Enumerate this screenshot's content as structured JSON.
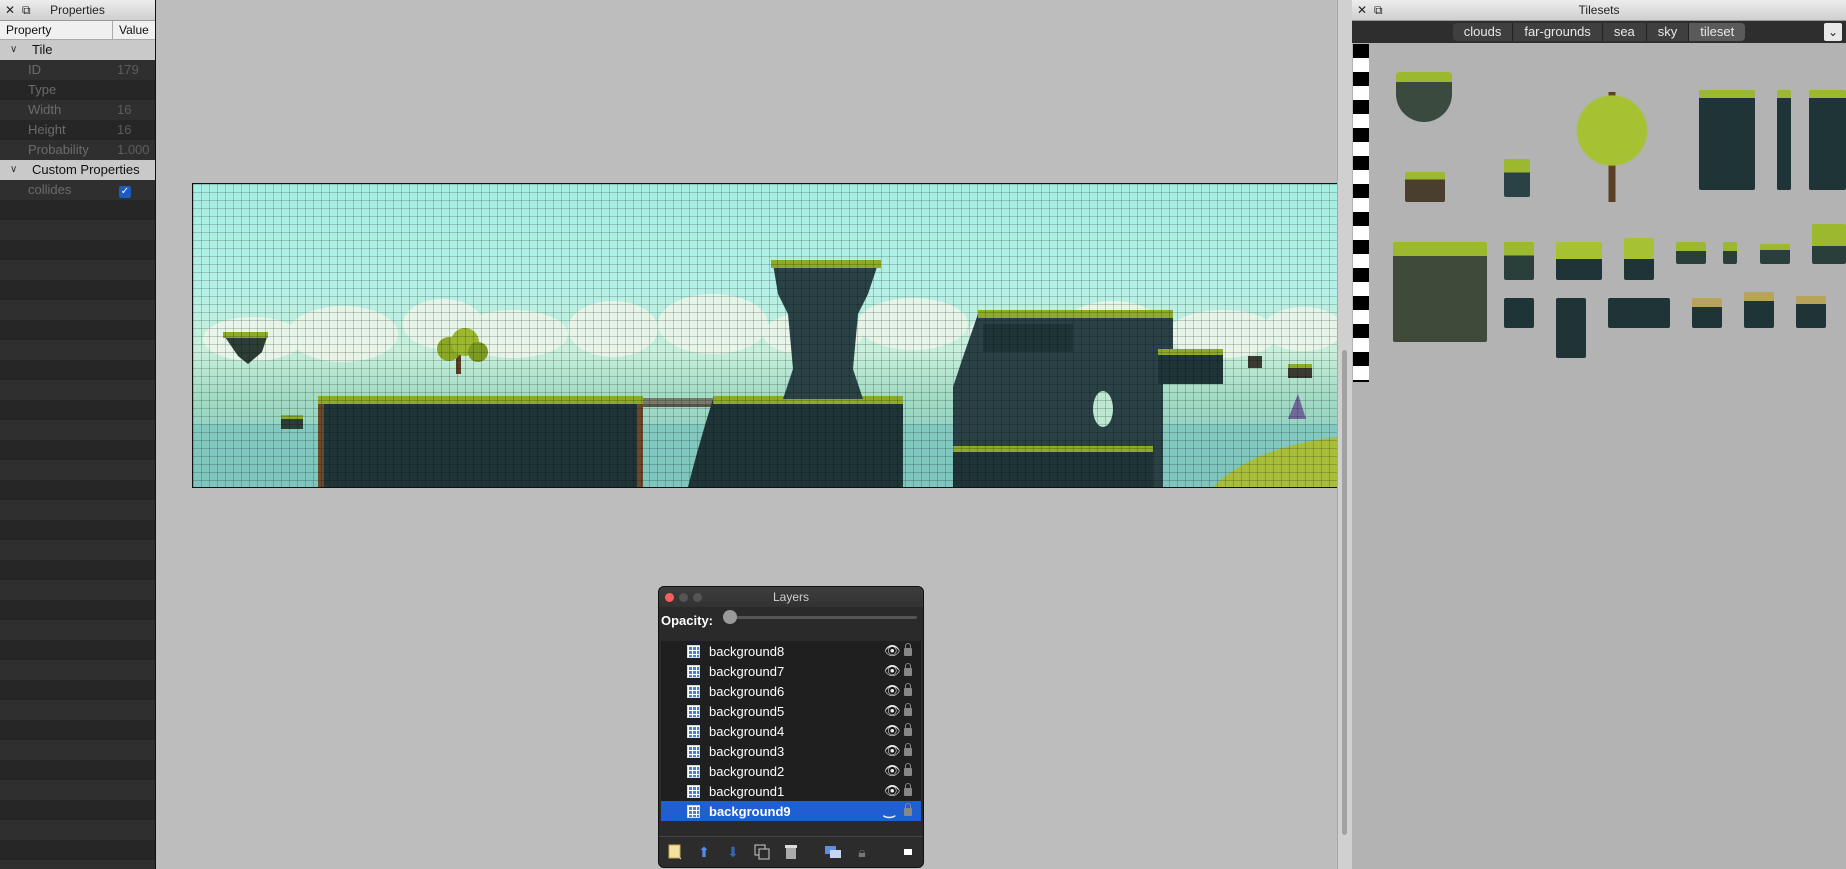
{
  "properties": {
    "title": "Properties",
    "columns": {
      "property": "Property",
      "value": "Value"
    },
    "tile_group": "Tile",
    "rows": [
      {
        "key": "ID",
        "value": "179"
      },
      {
        "key": "Type",
        "value": ""
      },
      {
        "key": "Width",
        "value": "16"
      },
      {
        "key": "Height",
        "value": "16"
      },
      {
        "key": "Probability",
        "value": "1.000"
      }
    ],
    "custom_group": "Custom Properties",
    "custom_rows": [
      {
        "key": "collides",
        "checked": true
      }
    ]
  },
  "layers": {
    "title": "Layers",
    "opacity_label": "Opacity:",
    "opacity": 0,
    "items": [
      {
        "name": "background8",
        "visible": true,
        "selected": false
      },
      {
        "name": "background7",
        "visible": true,
        "selected": false
      },
      {
        "name": "background6",
        "visible": true,
        "selected": false
      },
      {
        "name": "background5",
        "visible": true,
        "selected": false
      },
      {
        "name": "background4",
        "visible": true,
        "selected": false
      },
      {
        "name": "background3",
        "visible": true,
        "selected": false
      },
      {
        "name": "background2",
        "visible": true,
        "selected": false
      },
      {
        "name": "background1",
        "visible": true,
        "selected": false
      },
      {
        "name": "background9",
        "visible": false,
        "selected": true
      }
    ],
    "toolbar_icons": [
      "new-layer-icon",
      "raise-layer-icon",
      "lower-layer-icon",
      "duplicate-layer-icon",
      "delete-layer-icon",
      "show-other-layers-icon",
      "lock-layer-icon",
      "more-icon"
    ]
  },
  "tilesets": {
    "title": "Tilesets",
    "tabs": [
      "clouds",
      "far-grounds",
      "sea",
      "sky",
      "tileset"
    ],
    "active_tab": "tileset"
  },
  "colors": {
    "selection": "#1f5fcf",
    "panel_dark": "#262626",
    "sky": "#a7eee2",
    "ground_dark": "#1e3437",
    "grass": "#8eaa2a"
  }
}
